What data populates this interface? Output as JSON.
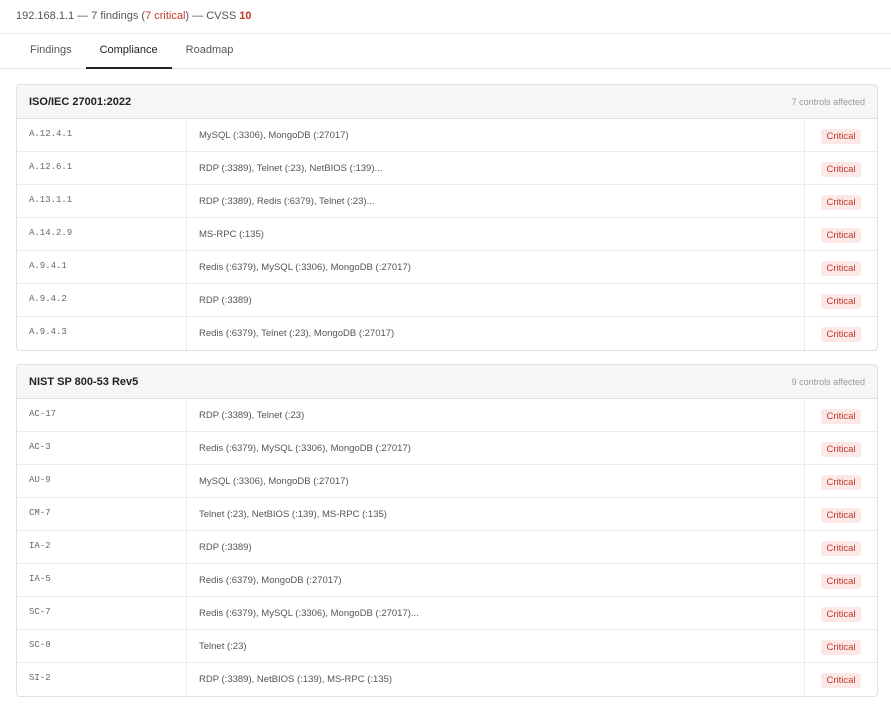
{
  "header": {
    "host": "192.168.1.1",
    "sep1": " — ",
    "findings": "7 findings",
    "open_paren": " (",
    "critical": "7 critical",
    "close_paren": ")",
    "sep2": " — CVSS ",
    "score": "10"
  },
  "tabs": [
    "Findings",
    "Compliance",
    "Roadmap"
  ],
  "active_tab": "Compliance",
  "colors": {
    "critical": "#c0392b",
    "badge_bg": "#fde8e8"
  },
  "frameworks": [
    {
      "title": "ISO/IEC 27001:2022",
      "count": "7 controls affected",
      "rows": [
        {
          "id": "A.12.4.1",
          "services": "MySQL (:3306), MongoDB (:27017)",
          "severity": "Critical"
        },
        {
          "id": "A.12.6.1",
          "services": "RDP (:3389), Telnet (:23), NetBIOS (:139)...",
          "severity": "Critical"
        },
        {
          "id": "A.13.1.1",
          "services": "RDP (:3389), Redis (:6379), Telnet (:23)...",
          "severity": "Critical"
        },
        {
          "id": "A.14.2.9",
          "services": "MS-RPC (:135)",
          "severity": "Critical"
        },
        {
          "id": "A.9.4.1",
          "services": "Redis (:6379), MySQL (:3306), MongoDB (:27017)",
          "severity": "Critical"
        },
        {
          "id": "A.9.4.2",
          "services": "RDP (:3389)",
          "severity": "Critical"
        },
        {
          "id": "A.9.4.3",
          "services": "Redis (:6379), Telnet (:23), MongoDB (:27017)",
          "severity": "Critical"
        }
      ]
    },
    {
      "title": "NIST SP 800-53 Rev5",
      "count": "9 controls affected",
      "rows": [
        {
          "id": "AC-17",
          "services": "RDP (:3389), Telnet (:23)",
          "severity": "Critical"
        },
        {
          "id": "AC-3",
          "services": "Redis (:6379), MySQL (:3306), MongoDB (:27017)",
          "severity": "Critical"
        },
        {
          "id": "AU-9",
          "services": "MySQL (:3306), MongoDB (:27017)",
          "severity": "Critical"
        },
        {
          "id": "CM-7",
          "services": "Telnet (:23), NetBIOS (:139), MS-RPC (:135)",
          "severity": "Critical"
        },
        {
          "id": "IA-2",
          "services": "RDP (:3389)",
          "severity": "Critical"
        },
        {
          "id": "IA-5",
          "services": "Redis (:6379), MongoDB (:27017)",
          "severity": "Critical"
        },
        {
          "id": "SC-7",
          "services": "Redis (:6379), MySQL (:3306), MongoDB (:27017)...",
          "severity": "Critical"
        },
        {
          "id": "SC-8",
          "services": "Telnet (:23)",
          "severity": "Critical"
        },
        {
          "id": "SI-2",
          "services": "RDP (:3389), NetBIOS (:139), MS-RPC (:135)",
          "severity": "Critical"
        }
      ]
    }
  ]
}
